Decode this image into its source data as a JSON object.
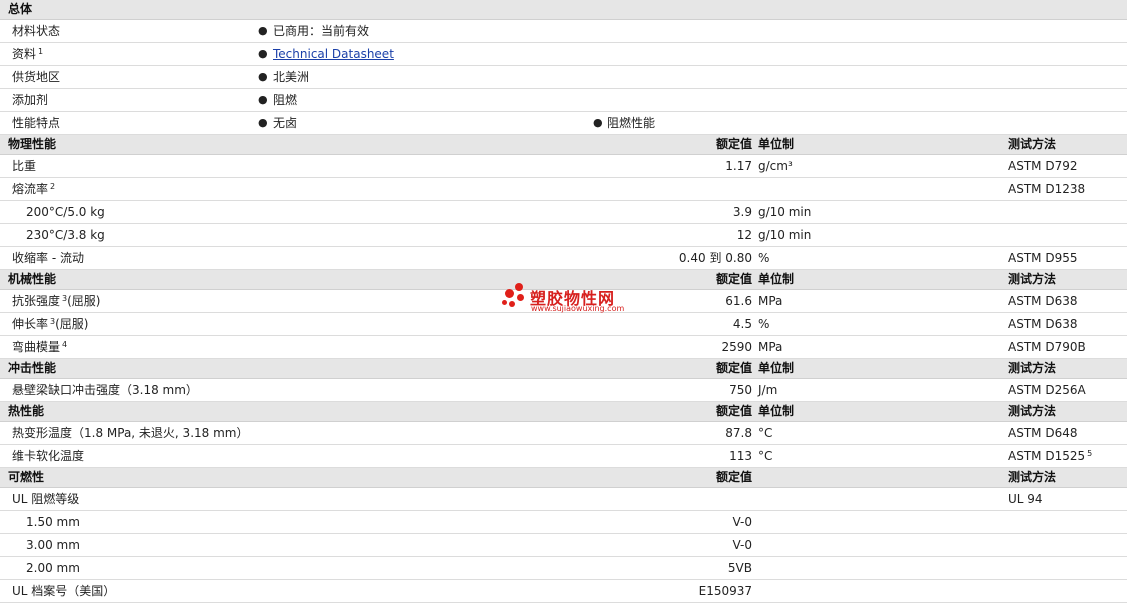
{
  "general": {
    "header": "总体",
    "rows": [
      {
        "label": "材料状态",
        "values": [
          "已商用：当前有效"
        ]
      },
      {
        "label": "资料",
        "sup": "1",
        "link": "Technical Datasheet"
      },
      {
        "label": "供货地区",
        "values": [
          "北美洲"
        ]
      },
      {
        "label": "添加剂",
        "values": [
          "阻燃"
        ]
      },
      {
        "label": "性能特点",
        "values": [
          "无卤",
          "阻燃性能"
        ]
      }
    ]
  },
  "columns": {
    "rated": "额定值",
    "unit": "单位制",
    "method": "测试方法"
  },
  "bullet": "●",
  "sections": [
    {
      "header": "物理性能",
      "show_unit": true,
      "rows": [
        {
          "label": "比重",
          "value": "1.17",
          "unit": "g/cm³",
          "method": "ASTM D792"
        },
        {
          "label": "熔流率",
          "sup": "2",
          "value": "",
          "unit": "",
          "method": "ASTM D1238"
        },
        {
          "label": "200°C/5.0 kg",
          "indent": true,
          "value": "3.9",
          "unit": "g/10 min",
          "method": ""
        },
        {
          "label": "230°C/3.8 kg",
          "indent": true,
          "value": "12",
          "unit": "g/10 min",
          "method": ""
        },
        {
          "label": "收缩率 - 流动",
          "value": "0.40 到  0.80",
          "unit": "%",
          "method": "ASTM D955"
        }
      ]
    },
    {
      "header": "机械性能",
      "show_unit": true,
      "rows": [
        {
          "label": "抗张强度",
          "sup": "3",
          "suffix": "(屈服)",
          "value": "61.6",
          "unit": "MPa",
          "method": "ASTM D638"
        },
        {
          "label": "伸长率",
          "sup": "3",
          "suffix": "(屈服)",
          "value": "4.5",
          "unit": "%",
          "method": "ASTM D638"
        },
        {
          "label": "弯曲模量",
          "sup": "4",
          "value": "2590",
          "unit": "MPa",
          "method": "ASTM D790B"
        }
      ]
    },
    {
      "header": "冲击性能",
      "show_unit": true,
      "rows": [
        {
          "label": "悬壁梁缺口冲击强度（3.18 mm）",
          "value": "750",
          "unit": "J/m",
          "method": "ASTM D256A"
        }
      ]
    },
    {
      "header": "热性能",
      "show_unit": true,
      "rows": [
        {
          "label": "热变形温度（1.8 MPa, 未退火, 3.18 mm）",
          "value": "87.8",
          "unit": "°C",
          "method": "ASTM D648"
        },
        {
          "label": "维卡软化温度",
          "value": "113",
          "unit": "°C",
          "method": "ASTM D1525",
          "method_sup": "5"
        }
      ]
    },
    {
      "header": "可燃性",
      "show_unit": false,
      "rows": [
        {
          "label": "UL 阻燃等级",
          "value": "",
          "unit": "",
          "method": "UL 94"
        },
        {
          "label": "1.50 mm",
          "indent": true,
          "value": "V-0",
          "unit": "",
          "method": ""
        },
        {
          "label": "3.00 mm",
          "indent": true,
          "value": "V-0",
          "unit": "",
          "method": ""
        },
        {
          "label": "2.00 mm",
          "indent": true,
          "value": "5VB",
          "unit": "",
          "method": ""
        },
        {
          "label": "UL 档案号（美国）",
          "value": "E150937",
          "unit": "",
          "method": ""
        }
      ]
    }
  ],
  "watermark": {
    "cn": "塑胶物性网",
    "en": "www.sujiaowuxing.com",
    "color": "#d7201e"
  }
}
